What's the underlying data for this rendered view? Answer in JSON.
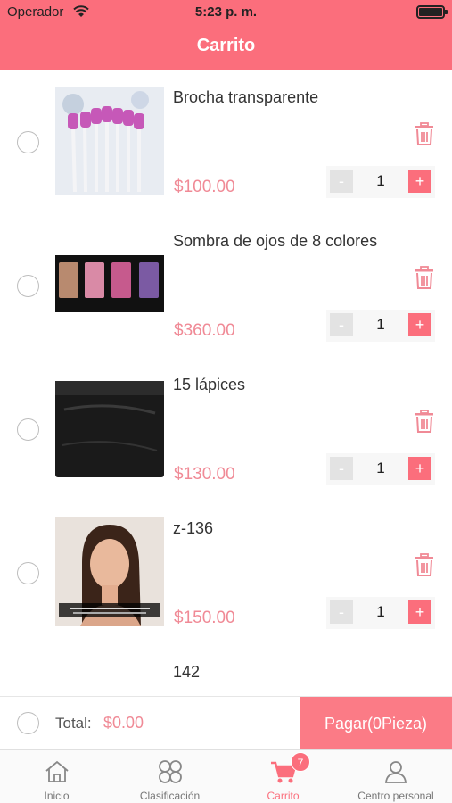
{
  "status_bar": {
    "carrier": "Operador",
    "time": "5:23 p. m."
  },
  "nav": {
    "title": "Carrito"
  },
  "items": [
    {
      "name": "Brocha transparente",
      "price": "$100.00",
      "quantity": "1",
      "image": "brush-set"
    },
    {
      "name": "Sombra de ojos de 8 colores",
      "price": "$360.00",
      "quantity": "1",
      "image": "eyeshadow-palette"
    },
    {
      "name": "15 lápices",
      "price": "$130.00",
      "quantity": "1",
      "image": "pencil-case"
    },
    {
      "name": "z-136",
      "price": "$150.00",
      "quantity": "1",
      "image": "model-portrait"
    },
    {
      "name": "142",
      "price": "",
      "quantity": "",
      "image": "lipstick"
    }
  ],
  "stepper": {
    "minus": "-",
    "plus": "+"
  },
  "summary": {
    "total_label": "Total:",
    "total_value": "$0.00",
    "pay_label": "Pagar(0Pieza)"
  },
  "tabs": [
    {
      "label": "Inicio",
      "icon": "home-icon"
    },
    {
      "label": "Clasificación",
      "icon": "category-icon"
    },
    {
      "label": "Carrito",
      "icon": "cart-icon",
      "badge": "7",
      "active": true
    },
    {
      "label": "Centro personal",
      "icon": "person-icon"
    }
  ],
  "colors": {
    "accent": "#fb6e7c",
    "price": "#f08a96",
    "pay": "#fb7b86"
  }
}
